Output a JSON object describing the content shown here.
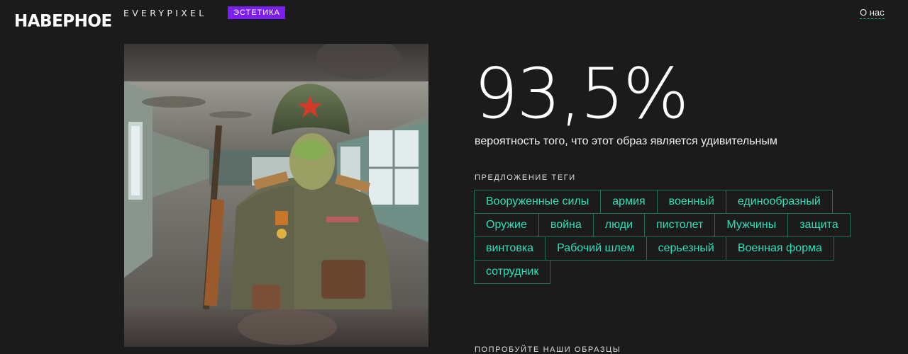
{
  "header": {
    "logo": "НАВЕРНОЕ",
    "brand": "EVERYPIXEL",
    "badge": "ЭСТЕТИКА",
    "about_link": "О нас"
  },
  "result": {
    "percent": "93,5%",
    "description": "вероятность того, что этот образ является удивительным"
  },
  "tags_section": {
    "title": "ПРЕДЛОЖЕНИЕ ТЕГИ",
    "rows": [
      [
        "Вооруженные силы",
        "армия",
        "военный",
        "единообразный"
      ],
      [
        "Оружие",
        "война",
        "люди",
        "пистолет",
        "Мужчины",
        "защита"
      ],
      [
        "винтовка",
        "Рабочий шлем",
        "серьезный",
        "Военная форма"
      ],
      [
        "сотрудник"
      ]
    ]
  },
  "samples_section": {
    "title": "ПОПРОБУЙТЕ НАШИ ОБРАЗЦЫ"
  },
  "colors": {
    "background": "#1b1b1b",
    "accent_purple": "#7a1ff0",
    "tag_text": "#2ee0b6",
    "tag_border": "#1f6f5c"
  }
}
